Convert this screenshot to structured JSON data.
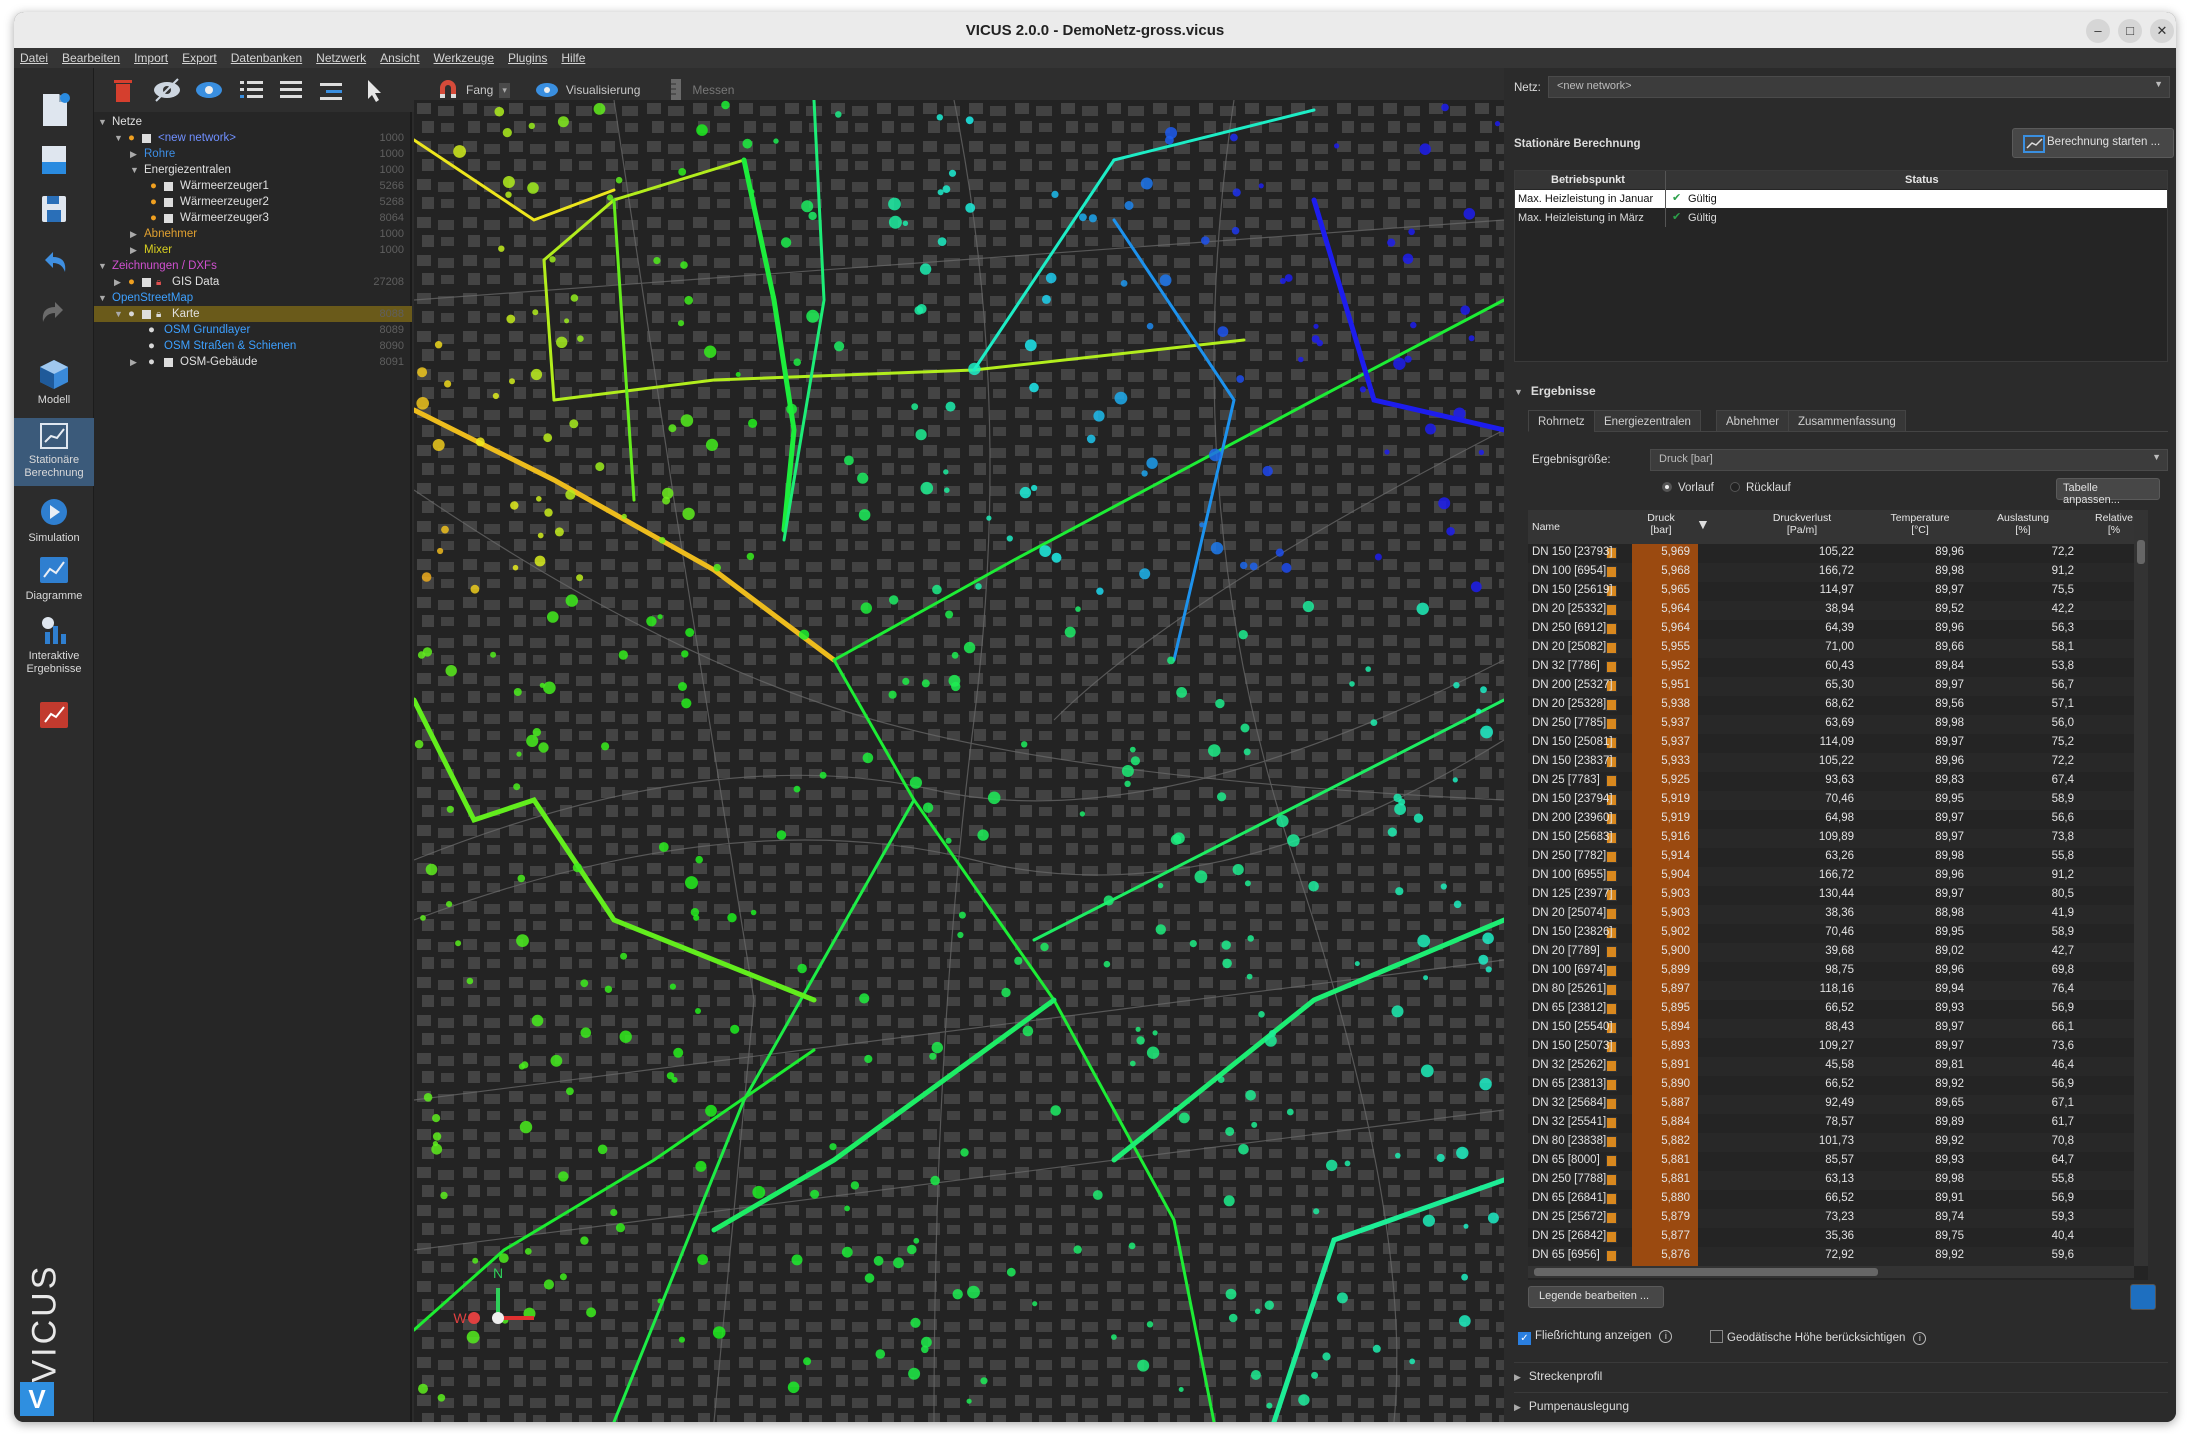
{
  "window": {
    "title": "VICUS 2.0.0 - DemoNetz-gross.vicus"
  },
  "menu": [
    "Datei",
    "Bearbeiten",
    "Import",
    "Export",
    "Datenbanken",
    "Netzwerk",
    "Ansicht",
    "Werkzeuge",
    "Plugins",
    "Hilfe"
  ],
  "sidebar": {
    "items": [
      "Modell",
      "Stationäre Berechnung",
      "Simulation",
      "Diagramme",
      "Interaktive Ergebnisse"
    ],
    "brand": "VICUS"
  },
  "toolbar": {
    "fang": "Fang",
    "visualisierung": "Visualisierung",
    "messen": "Messen"
  },
  "tree": {
    "items": [
      {
        "label": "Netze",
        "id": "",
        "color": "#e0e0e0"
      },
      {
        "label": "<new network>",
        "id": "1000",
        "color": "#6f8fff"
      },
      {
        "label": "Rohre",
        "id": "1000",
        "color": "#3d8fe6"
      },
      {
        "label": "Energiezentralen",
        "id": "1000",
        "color": "#e0e0e0"
      },
      {
        "label": "Wärmeerzeuger1",
        "id": "5266",
        "color": "#e0e0e0"
      },
      {
        "label": "Wärmeerzeuger2",
        "id": "5268",
        "color": "#e0e0e0"
      },
      {
        "label": "Wärmeerzeuger3",
        "id": "8064",
        "color": "#e0e0e0"
      },
      {
        "label": "Abnehmer",
        "id": "1000",
        "color": "#e0a030"
      },
      {
        "label": "Mixer",
        "id": "1000",
        "color": "#d8d020"
      },
      {
        "label": "Zeichnungen / DXFs",
        "id": "",
        "color": "#d050d0"
      },
      {
        "label": "GIS Data",
        "id": "27208",
        "color": "#e0e0e0"
      },
      {
        "label": "OpenStreetMap",
        "id": "",
        "color": "#3da0ff"
      },
      {
        "label": "Karte",
        "id": "8088",
        "color": "#e0e0e0"
      },
      {
        "label": "OSM Grundlayer",
        "id": "8089",
        "color": "#3da0ff"
      },
      {
        "label": "OSM Straßen & Schienen",
        "id": "8090",
        "color": "#3da0ff"
      },
      {
        "label": "OSM-Gebäude",
        "id": "8091",
        "color": "#e0e0e0"
      }
    ]
  },
  "map": {
    "compass_n": "N",
    "compass_w": "W"
  },
  "right": {
    "netz_label": "Netz:",
    "netz_value": "<new network>",
    "stat_label": "Stationäre Berechnung",
    "start_button": "Berechnung starten ...",
    "bp_headers": [
      "Betriebspunkt",
      "Status"
    ],
    "bp_rows": [
      {
        "name": "Max. Heizleistung in Januar",
        "status": "Gültig"
      },
      {
        "name": "Max. Heizleistung in März",
        "status": "Gültig"
      }
    ],
    "ergebnisse": "Ergebnisse",
    "tabs": [
      "Rohrnetz",
      "Energiezentralen",
      "Abnehmer",
      "Zusammenfassung"
    ],
    "groesse_label": "Ergebnisgröße:",
    "groesse_value": "Druck [bar]",
    "vorlauf": "Vorlauf",
    "ruecklauf": "Rücklauf",
    "tabelle_button": "Tabelle anpassen...",
    "columns": [
      "Name",
      "Druck\n[bar]",
      "Druckverlust\n[Pa/m]",
      "Temperature\n[°C]",
      "Auslastung\n[%]",
      "Relative\n[%"
    ],
    "rows": [
      [
        "DN 150 [23793]",
        "5,969",
        "105,22",
        "89,96",
        "72,2"
      ],
      [
        "DN 100 [6954]",
        "5,968",
        "166,72",
        "89,98",
        "91,2"
      ],
      [
        "DN 150 [25619]",
        "5,965",
        "114,97",
        "89,97",
        "75,5"
      ],
      [
        "DN 20 [25332]",
        "5,964",
        "38,94",
        "89,52",
        "42,2"
      ],
      [
        "DN 250 [6912]",
        "5,964",
        "64,39",
        "89,96",
        "56,3"
      ],
      [
        "DN 20 [25082]",
        "5,955",
        "71,00",
        "89,66",
        "58,1"
      ],
      [
        "DN 32 [7786]",
        "5,952",
        "60,43",
        "89,84",
        "53,8"
      ],
      [
        "DN 200 [25327]",
        "5,951",
        "65,30",
        "89,97",
        "56,7"
      ],
      [
        "DN 20 [25328]",
        "5,938",
        "68,62",
        "89,56",
        "57,1"
      ],
      [
        "DN 250 [7785]",
        "5,937",
        "63,69",
        "89,98",
        "56,0"
      ],
      [
        "DN 150 [25081]",
        "5,937",
        "114,09",
        "89,97",
        "75,2"
      ],
      [
        "DN 150 [23837]",
        "5,933",
        "105,22",
        "89,96",
        "72,2"
      ],
      [
        "DN 25 [7783]",
        "5,925",
        "93,63",
        "89,83",
        "67,4"
      ],
      [
        "DN 150 [23794]",
        "5,919",
        "70,46",
        "89,95",
        "58,9"
      ],
      [
        "DN 200 [23960]",
        "5,919",
        "64,98",
        "89,97",
        "56,6"
      ],
      [
        "DN 150 [25683]",
        "5,916",
        "109,89",
        "89,97",
        "73,8"
      ],
      [
        "DN 250 [7782]",
        "5,914",
        "63,26",
        "89,98",
        "55,8"
      ],
      [
        "DN 100 [6955]",
        "5,904",
        "166,72",
        "89,96",
        "91,2"
      ],
      [
        "DN 125 [23977]",
        "5,903",
        "130,44",
        "89,97",
        "80,5"
      ],
      [
        "DN 20 [25074]",
        "5,903",
        "38,36",
        "88,98",
        "41,9"
      ],
      [
        "DN 150 [23826]",
        "5,902",
        "70,46",
        "89,95",
        "58,9"
      ],
      [
        "DN 20 [7789]",
        "5,900",
        "39,68",
        "89,02",
        "42,7"
      ],
      [
        "DN 100 [6974]",
        "5,899",
        "98,75",
        "89,96",
        "69,8"
      ],
      [
        "DN 80 [25261]",
        "5,897",
        "118,16",
        "89,94",
        "76,4"
      ],
      [
        "DN 65 [23812]",
        "5,895",
        "66,52",
        "89,93",
        "56,9"
      ],
      [
        "DN 150 [25540]",
        "5,894",
        "88,43",
        "89,97",
        "66,1"
      ],
      [
        "DN 150 [25073]",
        "5,893",
        "109,27",
        "89,97",
        "73,6"
      ],
      [
        "DN 32 [25262]",
        "5,891",
        "45,58",
        "89,81",
        "46,4"
      ],
      [
        "DN 65 [23813]",
        "5,890",
        "66,52",
        "89,92",
        "56,9"
      ],
      [
        "DN 32 [25684]",
        "5,887",
        "92,49",
        "89,65",
        "67,1"
      ],
      [
        "DN 32 [25541]",
        "5,884",
        "78,57",
        "89,89",
        "61,7"
      ],
      [
        "DN 80 [23838]",
        "5,882",
        "101,73",
        "89,92",
        "70,8"
      ],
      [
        "DN 65 [8000]",
        "5,881",
        "85,57",
        "89,93",
        "64,7"
      ],
      [
        "DN 250 [7788]",
        "5,881",
        "63,13",
        "89,98",
        "55,8"
      ],
      [
        "DN 65 [26841]",
        "5,880",
        "66,52",
        "89,91",
        "56,9"
      ],
      [
        "DN 25 [25672]",
        "5,879",
        "73,23",
        "89,74",
        "59,3"
      ],
      [
        "DN 25 [26842]",
        "5,877",
        "35,36",
        "89,75",
        "40,4"
      ],
      [
        "DN 65 [6956]",
        "5,876",
        "72,92",
        "89,92",
        "59,6"
      ]
    ],
    "legende_button": "Legende bearbeiten ...",
    "fliess": "Fließrichtung anzeigen",
    "geodaet": "Geodätische Höhe berücksichtigen",
    "strecken": "Streckenprofil",
    "pumpen": "Pumpenauslegung"
  }
}
